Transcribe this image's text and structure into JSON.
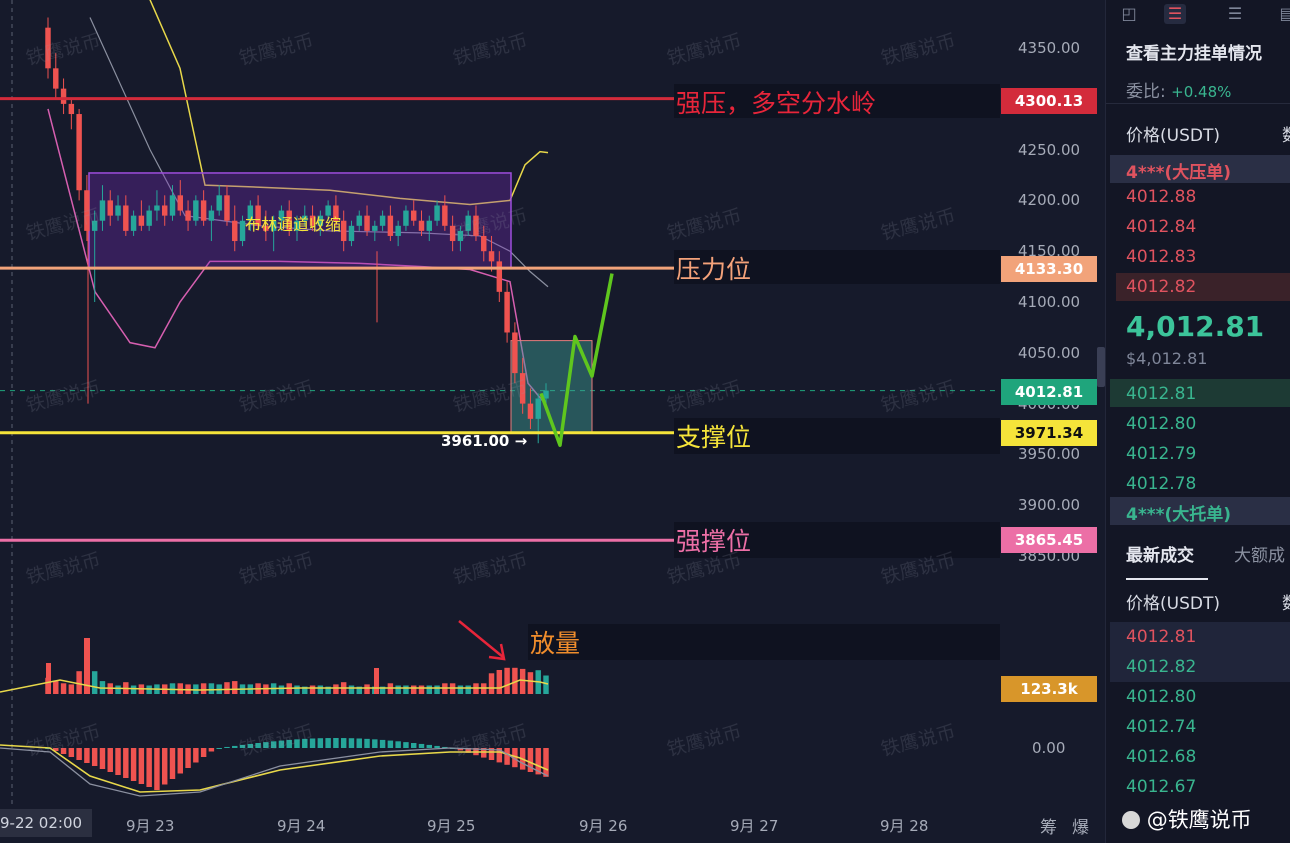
{
  "chart_data": {
    "type": "candlestick",
    "pair_quote": "USDT",
    "y_axis_ticks": [
      "4350.00",
      "4300.00",
      "4250.00",
      "4200.00",
      "4150.00",
      "4100.00",
      "4050.00",
      "4000.00",
      "3950.00",
      "3900.00",
      "3850.00"
    ],
    "ylim": [
      3830,
      4380
    ],
    "x_axis_ticks": [
      "9-22 02:00",
      "9月 23",
      "9月 24",
      "9月 25",
      "9月 26",
      "9月 27",
      "9月 28"
    ],
    "levels": [
      {
        "price": 4300.13,
        "label": "4300.13",
        "annotation": "强压，多空分水岭",
        "color": "#d32b3b"
      },
      {
        "price": 4133.3,
        "label": "4133.30",
        "annotation": "压力位",
        "color": "#f2a37a"
      },
      {
        "price": 3971.34,
        "label": "3971.34",
        "annotation": "支撑位",
        "color": "#f5e43a"
      },
      {
        "price": 3865.45,
        "label": "3865.45",
        "annotation": "强撑位",
        "color": "#ec6fa6"
      }
    ],
    "current_price": {
      "value": 4012.81,
      "label": "4012.81"
    },
    "low_marker": "3961.00",
    "box_annotation": "布林通道收缩",
    "volume_annotation": "放量",
    "volume_label": "123.3k",
    "macd_zero_label": "0.00",
    "candles_ohlc": [
      [
        4370,
        4380,
        4320,
        4330
      ],
      [
        4330,
        4345,
        4300,
        4310
      ],
      [
        4310,
        4320,
        4285,
        4295
      ],
      [
        4295,
        4300,
        4270,
        4285
      ],
      [
        4285,
        4290,
        4200,
        4210
      ],
      [
        4210,
        4225,
        4160,
        4170
      ],
      [
        4170,
        4190,
        4100,
        4180
      ],
      [
        4180,
        4215,
        4170,
        4200
      ],
      [
        4200,
        4210,
        4175,
        4185
      ],
      [
        4185,
        4205,
        4180,
        4195
      ],
      [
        4195,
        4205,
        4165,
        4170
      ],
      [
        4170,
        4190,
        4165,
        4185
      ],
      [
        4185,
        4200,
        4170,
        4175
      ],
      [
        4175,
        4195,
        4170,
        4190
      ],
      [
        4190,
        4210,
        4180,
        4195
      ],
      [
        4195,
        4205,
        4175,
        4185
      ],
      [
        4185,
        4215,
        4180,
        4205
      ],
      [
        4205,
        4220,
        4185,
        4190
      ],
      [
        4190,
        4200,
        4170,
        4180
      ],
      [
        4180,
        4205,
        4175,
        4200
      ],
      [
        4200,
        4210,
        4175,
        4180
      ],
      [
        4180,
        4195,
        4160,
        4190
      ],
      [
        4190,
        4215,
        4185,
        4205
      ],
      [
        4205,
        4215,
        4175,
        4180
      ],
      [
        4180,
        4195,
        4150,
        4160
      ],
      [
        4160,
        4185,
        4155,
        4180
      ],
      [
        4180,
        4200,
        4170,
        4195
      ],
      [
        4195,
        4205,
        4170,
        4175
      ],
      [
        4175,
        4190,
        4160,
        4170
      ],
      [
        4170,
        4185,
        4150,
        4180
      ],
      [
        4180,
        4195,
        4170,
        4190
      ],
      [
        4190,
        4200,
        4165,
        4170
      ],
      [
        4170,
        4185,
        4160,
        4180
      ],
      [
        4180,
        4195,
        4175,
        4185
      ],
      [
        4185,
        4195,
        4170,
        4175
      ],
      [
        4175,
        4190,
        4165,
        4185
      ],
      [
        4185,
        4200,
        4180,
        4195
      ],
      [
        4195,
        4205,
        4175,
        4180
      ],
      [
        4180,
        4190,
        4150,
        4160
      ],
      [
        4160,
        4180,
        4155,
        4175
      ],
      [
        4175,
        4190,
        4170,
        4185
      ],
      [
        4185,
        4195,
        4165,
        4170
      ],
      [
        4170,
        4180,
        4160,
        4175
      ],
      [
        4175,
        4190,
        4170,
        4185
      ],
      [
        4185,
        4195,
        4160,
        4165
      ],
      [
        4165,
        4180,
        4155,
        4175
      ],
      [
        4175,
        4195,
        4170,
        4190
      ],
      [
        4190,
        4200,
        4175,
        4180
      ],
      [
        4180,
        4190,
        4165,
        4170
      ],
      [
        4170,
        4185,
        4160,
        4180
      ],
      [
        4180,
        4200,
        4175,
        4195
      ],
      [
        4195,
        4205,
        4170,
        4175
      ],
      [
        4175,
        4185,
        4150,
        4160
      ],
      [
        4160,
        4175,
        4150,
        4170
      ],
      [
        4170,
        4190,
        4165,
        4185
      ],
      [
        4185,
        4195,
        4160,
        4165
      ],
      [
        4165,
        4175,
        4140,
        4150
      ],
      [
        4150,
        4165,
        4130,
        4140
      ],
      [
        4140,
        4150,
        4100,
        4110
      ],
      [
        4110,
        4120,
        4060,
        4070
      ],
      [
        4070,
        4080,
        4020,
        4030
      ],
      [
        4030,
        4045,
        3990,
        4000
      ],
      [
        4000,
        4015,
        3975,
        3985
      ],
      [
        3985,
        4010,
        3961,
        4005
      ],
      [
        4005,
        4020,
        3995,
        4012.81
      ]
    ]
  },
  "watermark_text": "铁鹰说币",
  "x_footer": [
    "筹",
    "爆"
  ],
  "credit": "@铁鹰说币",
  "sidebar": {
    "title": "查看主力挂单情况",
    "ratio_label": "委比:",
    "ratio_value": "+0.48%",
    "col_price": "价格(USDT)",
    "col_amount": "数",
    "big_ask_label": "4***(大压单)",
    "asks": [
      "4012.88",
      "4012.84",
      "4012.83",
      "4012.82"
    ],
    "last_price": "4,012.81",
    "last_price_usd": "$4,012.81",
    "bids": [
      "4012.81",
      "4012.80",
      "4012.79",
      "4012.78"
    ],
    "big_bid_label": "4***(大托单)",
    "tab_trades": "最新成交",
    "tab_big": "大额成",
    "col_price2": "价格(USDT)",
    "col_amount2": "数",
    "trades": [
      {
        "price": "4012.81",
        "side": "ask"
      },
      {
        "price": "4012.82",
        "side": "bid"
      },
      {
        "price": "4012.80",
        "side": "bid"
      },
      {
        "price": "4012.74",
        "side": "bid"
      },
      {
        "price": "4012.68",
        "side": "bid"
      },
      {
        "price": "4012.67",
        "side": "bid"
      }
    ]
  },
  "colors": {
    "up": "#26a69a",
    "down": "#ef5350",
    "projection": "#5fc61e",
    "box": "#7b2cbf",
    "pink": "#ec6fa6"
  }
}
